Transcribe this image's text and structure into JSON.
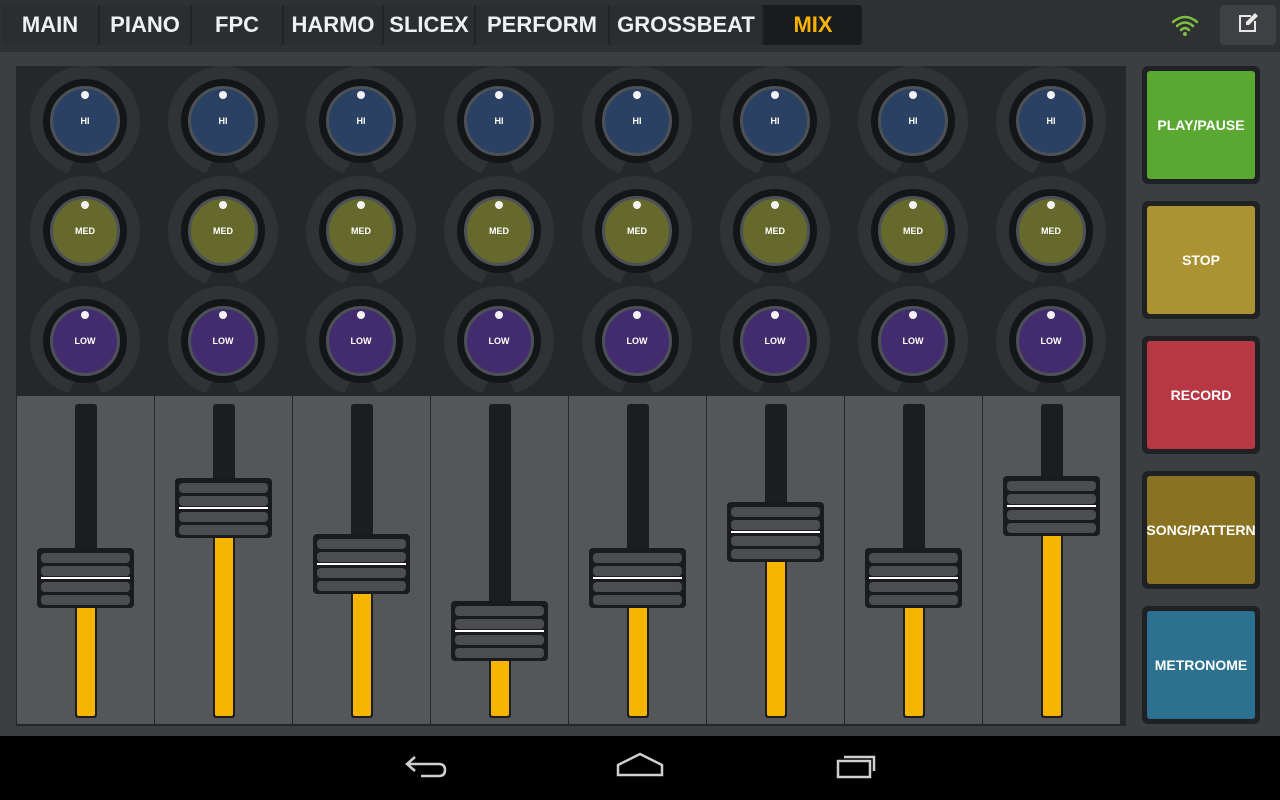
{
  "tabs": [
    {
      "label": "MAIN",
      "active": false
    },
    {
      "label": "PIANO",
      "active": false
    },
    {
      "label": "FPC",
      "active": false
    },
    {
      "label": "HARMO",
      "active": false
    },
    {
      "label": "SLICEX",
      "active": false
    },
    {
      "label": "PERFORM",
      "active": false
    },
    {
      "label": "GROSSBEAT",
      "active": false
    },
    {
      "label": "MIX",
      "active": true
    }
  ],
  "status": {
    "wifi_icon": "wifi-icon",
    "edit_icon": "edit-icon"
  },
  "knob_labels": {
    "hi": "HI",
    "med": "MED",
    "low": "LOW"
  },
  "colors": {
    "accent": "#f7b300",
    "knob_hi": "#2a4163",
    "knob_med": "#66692c",
    "knob_low": "#432c6e",
    "fader_fill": "#f7b500"
  },
  "channels": [
    {
      "level": 0.5
    },
    {
      "level": 0.79
    },
    {
      "level": 0.56
    },
    {
      "level": 0.28
    },
    {
      "level": 0.5
    },
    {
      "level": 0.69
    },
    {
      "level": 0.5
    },
    {
      "level": 0.8
    }
  ],
  "buttons": [
    {
      "label": "PLAY/PAUSE",
      "color": "#5aa832",
      "name": "play-pause-button"
    },
    {
      "label": "STOP",
      "color": "#ab9334",
      "name": "stop-button"
    },
    {
      "label": "RECORD",
      "color": "#b83745",
      "name": "record-button"
    },
    {
      "label": "SONG/PATTERN",
      "color": "#8a7223",
      "name": "song-pattern-button"
    },
    {
      "label": "METRONOME",
      "color": "#2d7190",
      "name": "metronome-button"
    }
  ],
  "navbar": {
    "back_icon": "back-icon",
    "home_icon": "home-icon",
    "recents_icon": "recents-icon"
  }
}
